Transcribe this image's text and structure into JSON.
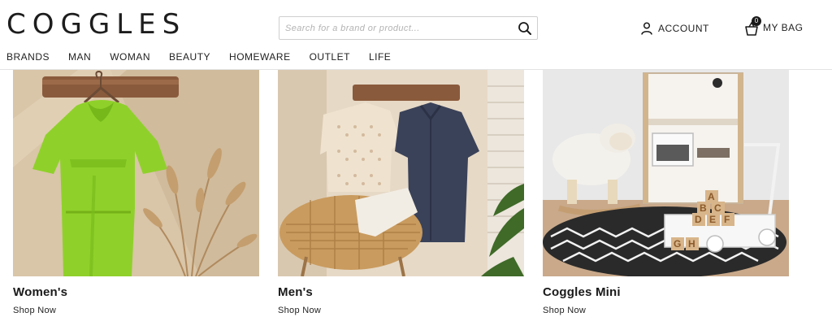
{
  "header": {
    "logo": "COGGLES",
    "search": {
      "placeholder": "Search for a brand or product..."
    },
    "account_label": "ACCOUNT",
    "bag_label": "MY BAG",
    "bag_count": "0"
  },
  "nav": {
    "items": [
      {
        "label": "BRANDS"
      },
      {
        "label": "MAN"
      },
      {
        "label": "WOMAN"
      },
      {
        "label": "BEAUTY"
      },
      {
        "label": "HOMEWARE"
      },
      {
        "label": "OUTLET"
      },
      {
        "label": "LIFE"
      }
    ]
  },
  "cards": [
    {
      "title": "Women's",
      "cta": "Shop Now"
    },
    {
      "title": "Men's",
      "cta": "Shop Now"
    },
    {
      "title": "Coggles Mini",
      "cta": "Shop Now"
    }
  ],
  "mini_blocks": [
    "A",
    "B",
    "C",
    "D",
    "E",
    "F",
    "G",
    "H"
  ],
  "colors": {
    "text": "#1a1a1a",
    "border": "#cfcfcf",
    "womens_bg": "#d9c5a8",
    "dress": "#8fd12a",
    "mens_bg": "#e6d9c6",
    "mini_bg": "#e8e8e8"
  },
  "icons": {
    "search": "search-icon",
    "account": "user-icon",
    "bag": "basket-icon"
  }
}
